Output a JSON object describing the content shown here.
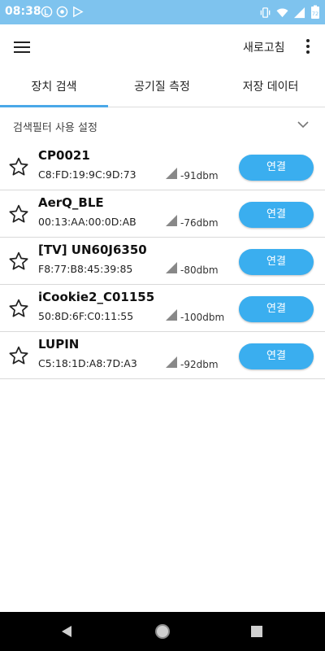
{
  "status_bar": {
    "time": "08:38",
    "battery_level": "72",
    "left_icons": [
      "notification-l-icon",
      "notification-circle-icon",
      "play-store-icon"
    ],
    "right_icons": [
      "vibrate-icon",
      "wifi-icon",
      "signal-icon",
      "battery-icon"
    ]
  },
  "app_bar": {
    "menu_icon": "hamburger-menu-icon",
    "refresh_label": "새로고침",
    "overflow_icon": "more-vert-icon"
  },
  "tabs": [
    {
      "label": "장치 검색",
      "selected": true
    },
    {
      "label": "공기질 측정",
      "selected": false
    },
    {
      "label": "저장 데이터",
      "selected": false
    }
  ],
  "filter": {
    "label": "검색필터 사용 설정",
    "icon": "chevron-down-icon"
  },
  "devices": [
    {
      "name": "CP0021",
      "mac": "C8:FD:19:9C:9D:73",
      "rssi": "-91dbm",
      "button": "연결"
    },
    {
      "name": "AerQ_BLE",
      "mac": "00:13:AA:00:0D:AB",
      "rssi": "-76dbm",
      "button": "연결"
    },
    {
      "name": "[TV] UN60J6350",
      "mac": "F8:77:B8:45:39:85",
      "rssi": "-80dbm",
      "button": "연결"
    },
    {
      "name": "iCookie2_C01155",
      "mac": "50:8D:6F:C0:11:55",
      "rssi": "-100dbm",
      "button": "연결"
    },
    {
      "name": "LUPIN",
      "mac": "C5:18:1D:A8:7D:A3",
      "rssi": "-92dbm",
      "button": "연결"
    }
  ],
  "colors": {
    "status_bar": "#7ec3ee",
    "accent": "#3aaeef",
    "tab_indicator": "#4aa8e8"
  },
  "nav_bar": {
    "icons": [
      "back-icon",
      "home-icon",
      "recents-icon"
    ]
  }
}
